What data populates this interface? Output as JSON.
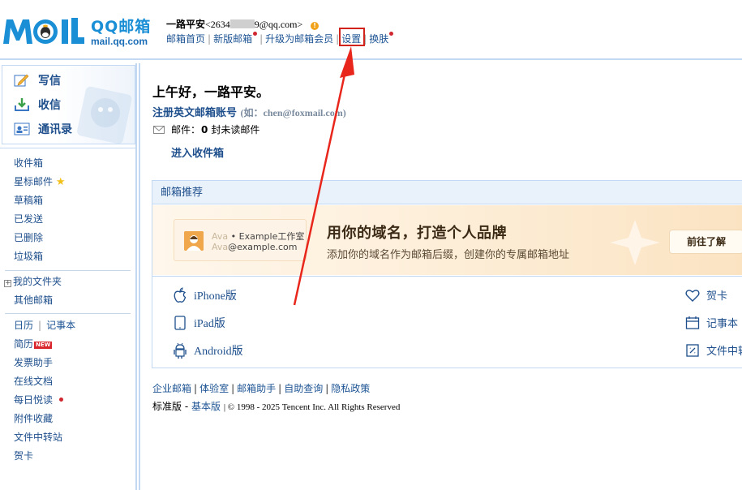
{
  "header": {
    "logo_cn": "QQ邮箱",
    "logo_en": "mail.qq.com",
    "user_name": "一路平安",
    "email_prefix": "<2634",
    "email_suffix": "9@qq.com>",
    "warning_badge": "!",
    "nav": [
      {
        "label": "邮箱首页",
        "dot": false
      },
      {
        "label": "新版邮箱",
        "dot": true
      },
      {
        "label": "升级为邮箱会员",
        "dot": false
      },
      {
        "label": "设置",
        "dot": false
      },
      {
        "label": "换肤",
        "dot": true
      }
    ]
  },
  "sidebar": {
    "quick": [
      {
        "label": "写信",
        "icon": "compose-icon"
      },
      {
        "label": "收信",
        "icon": "inbox-download-icon"
      },
      {
        "label": "通讯录",
        "icon": "contacts-icon"
      }
    ],
    "folders": [
      "收件箱",
      "星标邮件",
      "草稿箱",
      "已发送",
      "已删除",
      "垃圾箱"
    ],
    "my_folders": "我的文件夹",
    "other_mailbox": "其他邮箱",
    "calendar": "日历",
    "notepad": "记事本",
    "resume": "简历",
    "new_badge": "NEW",
    "tools": [
      "发票助手",
      "在线文档",
      "每日悦读",
      "附件收藏",
      "文件中转站",
      "贺卡"
    ]
  },
  "main": {
    "greeting": "上午好，一路平安。",
    "register": "注册英文邮箱账号",
    "register_hint": "(如：chen@foxmail.com)",
    "mail_label": "邮件：",
    "unread_count": "0",
    "unread_text": "封未读邮件",
    "enter_inbox": "进入收件箱",
    "rec_title": "邮箱推荐",
    "banner": {
      "card_line1_faint": "Ava",
      "card_line1": "• Example工作室",
      "card_line2_faint": "Ava",
      "card_line2": "@example.com",
      "title": "用你的域名，打造个人品牌",
      "subtitle": "添加你的域名作为邮箱后缀，创建你的专属邮箱地址",
      "button": "前往了解"
    },
    "apps_left": [
      "iPhone版",
      "iPad版",
      "Android版"
    ],
    "apps_right": [
      "贺卡",
      "记事本",
      "文件中转站"
    ]
  },
  "footer": {
    "links": [
      "企业邮箱",
      "体验室",
      "邮箱助手",
      "自助查询",
      "隐私政策"
    ],
    "edition": "标准版",
    "dash": " - ",
    "basic": "基本版",
    "copyright": "| © 1998 - 2025 Tencent Inc. All Rights Reserved"
  }
}
